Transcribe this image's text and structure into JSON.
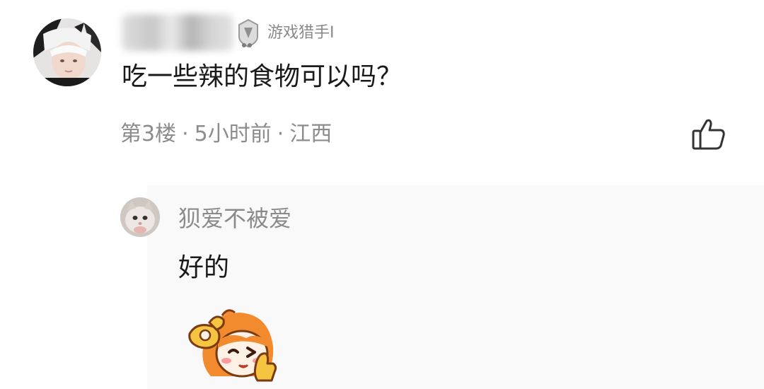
{
  "comment": {
    "badge": "游戏猎手I",
    "text": "吃一些辣的食物可以吗？",
    "meta": {
      "floor": "第3楼",
      "time": "5小时前",
      "location": "江西"
    }
  },
  "reply": {
    "username": "狈爱不被爱",
    "text": "好的"
  },
  "colors": {
    "meta_gray": "#8c8c8c",
    "reply_background": "#f9f9f9",
    "sticker_orange": "#f28a2e",
    "sticker_yellow": "#f5c542"
  },
  "icons": {
    "like": "thumbs-up-icon",
    "badge": "level-badge-icon"
  }
}
